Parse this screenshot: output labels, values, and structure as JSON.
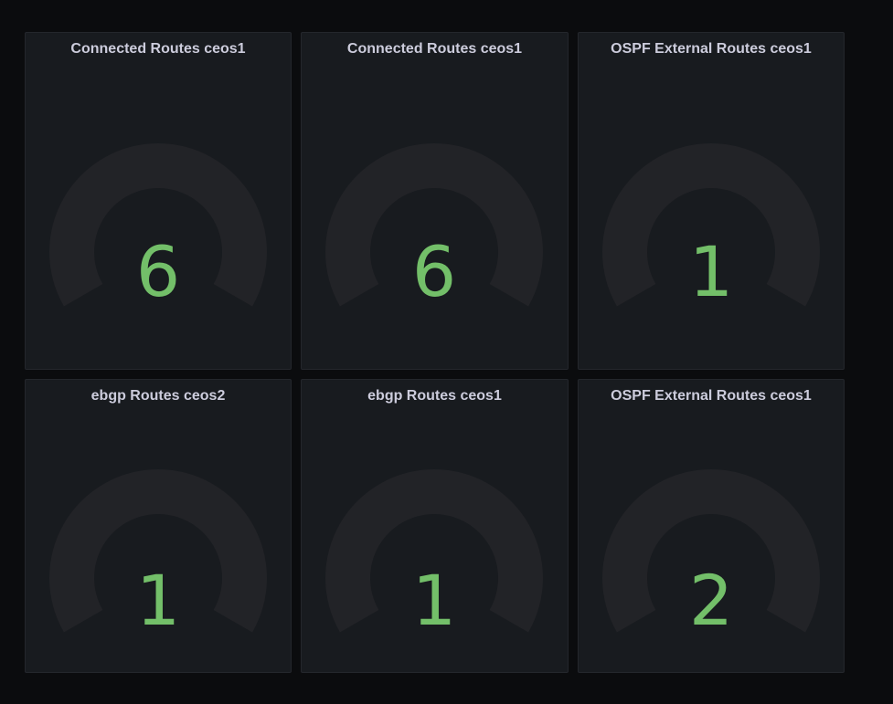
{
  "panels": [
    {
      "title": "Connected Routes ceos1",
      "value": "6",
      "gauge_level": 0
    },
    {
      "title": "Connected Routes ceos1",
      "value": "6",
      "gauge_level": 0
    },
    {
      "title": "OSPF External Routes ceos1",
      "value": "1",
      "gauge_level": 0
    },
    {
      "title": "ebgp Routes ceos2",
      "value": "1",
      "gauge_level": 0
    },
    {
      "title": "ebgp Routes ceos1",
      "value": "1",
      "gauge_level": 0
    },
    {
      "title": "OSPF External Routes ceos1",
      "value": "2",
      "gauge_level": 0
    }
  ],
  "colors": {
    "background": "#0b0c0e",
    "panel": "#181b1f",
    "gauge_track": "#222327",
    "value": "#73bf69",
    "title": "#ccccdc"
  }
}
